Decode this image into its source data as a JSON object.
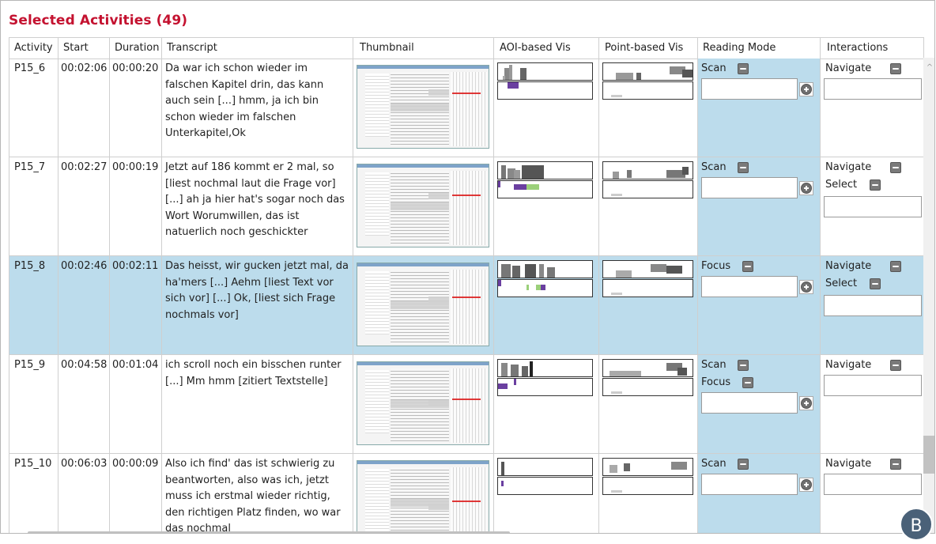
{
  "title": "Selected Activities (49)",
  "columns": [
    "Activity",
    "Start",
    "Duration",
    "Transcript",
    "Thumbnail",
    "AOI-based Vis",
    "Point-based Vis",
    "Reading Mode",
    "Interactions"
  ],
  "rows": [
    {
      "activity": "P15_6",
      "start": "00:02:06",
      "duration": "00:00:20",
      "transcript": "Da war ich schon wieder im falschen Kapitel drin, das kann auch sein [...] hmm, ja ich bin schon wieder im falschen Unterkapitel,Ok",
      "modes": [
        "Scan"
      ],
      "interactions": [
        "Navigate"
      ],
      "selected": false
    },
    {
      "activity": "P15_7",
      "start": "00:02:27",
      "duration": "00:00:19",
      "transcript": "Jetzt auf 186 kommt er 2 mal, so [liest nochmal laut die Frage vor] [...]  ah ja hier hat's sogar noch das Wort Worumwillen, das ist natuerlich noch geschickter",
      "modes": [
        "Scan"
      ],
      "interactions": [
        "Navigate",
        "Select"
      ],
      "selected": false
    },
    {
      "activity": "P15_8",
      "start": "00:02:46",
      "duration": "00:02:11",
      "transcript": "Das heisst, wir gucken jetzt mal, da ha'mers [...] Aehm [liest Text vor sich vor] [...] Ok, [liest sich Frage nochmals vor]",
      "modes": [
        "Focus"
      ],
      "interactions": [
        "Navigate",
        "Select"
      ],
      "selected": true
    },
    {
      "activity": "P15_9",
      "start": "00:04:58",
      "duration": "00:01:04",
      "transcript": "ich scroll noch ein bisschen runter [...] Mm hmm [zitiert Textstelle]",
      "modes": [
        "Scan",
        "Focus"
      ],
      "interactions": [
        "Navigate"
      ],
      "selected": false
    },
    {
      "activity": "P15_10",
      "start": "00:06:03",
      "duration": "00:00:09",
      "transcript": "Also ich find' das ist schwierig zu beantworten, also was ich, jetzt muss ich erstmal wieder richtig, den richtigen Platz finden, wo war das nochmal",
      "modes": [
        "Scan"
      ],
      "interactions": [
        "Navigate"
      ],
      "selected": false
    }
  ],
  "badge": "B",
  "colors": {
    "title": "#c41230",
    "selected_row": "#bcdcec",
    "aoi_purple": "#6a3fa0",
    "aoi_green": "#9bd07a"
  }
}
